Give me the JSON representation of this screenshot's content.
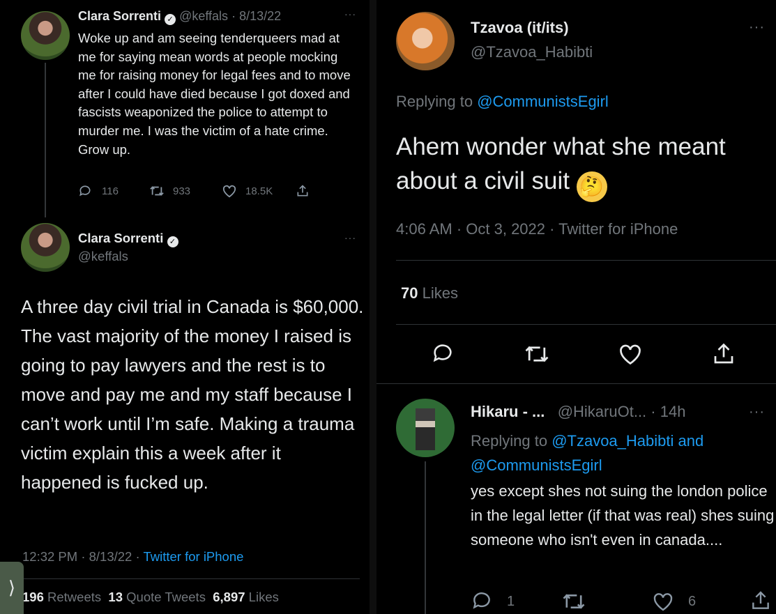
{
  "left": {
    "tweet1": {
      "name": "Clara Sorrenti",
      "handle": "@keffals",
      "date": "8/13/22",
      "text": "Woke up and am seeing tenderqueers mad at me for saying mean words at people mocking me for raising money for legal fees and to move after I could have died because I got doxed and fascists weaponized the police to attempt to murder me. I was the victim of a hate crime. Grow up.",
      "replies": "116",
      "retweets": "933",
      "likes": "18.5K"
    },
    "tweet2": {
      "name": "Clara Sorrenti",
      "handle": "@keffals",
      "text": "A three day civil trial in Canada is $60,000. The vast majority of the money I raised is going to pay lawyers and the rest is to move and pay me and my staff because I can’t work until I’m safe. Making a trauma victim explain this a week after it happened is fucked up.",
      "time": "12:32 PM · 8/13/22 · ",
      "source": "Twitter for iPhone",
      "retweets_count": "196",
      "retweets_label": "Retweets",
      "quotes_count": "13",
      "quotes_label": "Quote Tweets",
      "likes_count": "6,897",
      "likes_label": "Likes"
    },
    "side_tab_glyph": "⟩"
  },
  "right": {
    "main": {
      "name": "Tzavoa (it/its)",
      "handle": "@Tzavoa_Habibti",
      "replying_prefix": "Replying to ",
      "replying_to": "@CommunistsEgirl",
      "text": "Ahem wonder what she meant about a civil suit",
      "emoji": "🤔",
      "meta": "4:06 AM · Oct 3, 2022 · Twitter for iPhone",
      "likes_count": "70",
      "likes_label": "Likes"
    },
    "reply": {
      "name": "Hikaru - ...",
      "handle": "@HikaruOt...",
      "time": "· 14h",
      "replying_prefix": "Replying to ",
      "replying_to": "@Tzavoa_Habibti and @CommunistsEgirl",
      "text": "yes except shes not suing the london police in the legal letter (if that was real) shes suing someone who isn't even in canada....",
      "replies": "1",
      "likes": "6"
    },
    "more_glyph": "···"
  },
  "colors": {
    "background": "#000000",
    "text": "#e7e9ea",
    "muted": "#71767b",
    "link": "#1d9bf0",
    "divider": "#2f3336"
  }
}
